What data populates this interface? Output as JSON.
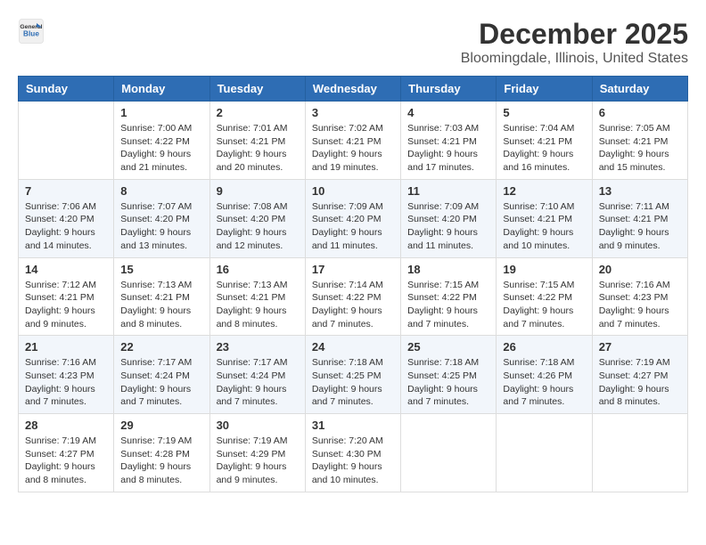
{
  "header": {
    "logo_line1": "General",
    "logo_line2": "Blue",
    "month": "December 2025",
    "location": "Bloomingdale, Illinois, United States"
  },
  "weekdays": [
    "Sunday",
    "Monday",
    "Tuesday",
    "Wednesday",
    "Thursday",
    "Friday",
    "Saturday"
  ],
  "weeks": [
    [
      {
        "day": "",
        "sunrise": "",
        "sunset": "",
        "daylight": ""
      },
      {
        "day": "1",
        "sunrise": "Sunrise: 7:00 AM",
        "sunset": "Sunset: 4:22 PM",
        "daylight": "Daylight: 9 hours and 21 minutes."
      },
      {
        "day": "2",
        "sunrise": "Sunrise: 7:01 AM",
        "sunset": "Sunset: 4:21 PM",
        "daylight": "Daylight: 9 hours and 20 minutes."
      },
      {
        "day": "3",
        "sunrise": "Sunrise: 7:02 AM",
        "sunset": "Sunset: 4:21 PM",
        "daylight": "Daylight: 9 hours and 19 minutes."
      },
      {
        "day": "4",
        "sunrise": "Sunrise: 7:03 AM",
        "sunset": "Sunset: 4:21 PM",
        "daylight": "Daylight: 9 hours and 17 minutes."
      },
      {
        "day": "5",
        "sunrise": "Sunrise: 7:04 AM",
        "sunset": "Sunset: 4:21 PM",
        "daylight": "Daylight: 9 hours and 16 minutes."
      },
      {
        "day": "6",
        "sunrise": "Sunrise: 7:05 AM",
        "sunset": "Sunset: 4:21 PM",
        "daylight": "Daylight: 9 hours and 15 minutes."
      }
    ],
    [
      {
        "day": "7",
        "sunrise": "Sunrise: 7:06 AM",
        "sunset": "Sunset: 4:20 PM",
        "daylight": "Daylight: 9 hours and 14 minutes."
      },
      {
        "day": "8",
        "sunrise": "Sunrise: 7:07 AM",
        "sunset": "Sunset: 4:20 PM",
        "daylight": "Daylight: 9 hours and 13 minutes."
      },
      {
        "day": "9",
        "sunrise": "Sunrise: 7:08 AM",
        "sunset": "Sunset: 4:20 PM",
        "daylight": "Daylight: 9 hours and 12 minutes."
      },
      {
        "day": "10",
        "sunrise": "Sunrise: 7:09 AM",
        "sunset": "Sunset: 4:20 PM",
        "daylight": "Daylight: 9 hours and 11 minutes."
      },
      {
        "day": "11",
        "sunrise": "Sunrise: 7:09 AM",
        "sunset": "Sunset: 4:20 PM",
        "daylight": "Daylight: 9 hours and 11 minutes."
      },
      {
        "day": "12",
        "sunrise": "Sunrise: 7:10 AM",
        "sunset": "Sunset: 4:21 PM",
        "daylight": "Daylight: 9 hours and 10 minutes."
      },
      {
        "day": "13",
        "sunrise": "Sunrise: 7:11 AM",
        "sunset": "Sunset: 4:21 PM",
        "daylight": "Daylight: 9 hours and 9 minutes."
      }
    ],
    [
      {
        "day": "14",
        "sunrise": "Sunrise: 7:12 AM",
        "sunset": "Sunset: 4:21 PM",
        "daylight": "Daylight: 9 hours and 9 minutes."
      },
      {
        "day": "15",
        "sunrise": "Sunrise: 7:13 AM",
        "sunset": "Sunset: 4:21 PM",
        "daylight": "Daylight: 9 hours and 8 minutes."
      },
      {
        "day": "16",
        "sunrise": "Sunrise: 7:13 AM",
        "sunset": "Sunset: 4:21 PM",
        "daylight": "Daylight: 9 hours and 8 minutes."
      },
      {
        "day": "17",
        "sunrise": "Sunrise: 7:14 AM",
        "sunset": "Sunset: 4:22 PM",
        "daylight": "Daylight: 9 hours and 7 minutes."
      },
      {
        "day": "18",
        "sunrise": "Sunrise: 7:15 AM",
        "sunset": "Sunset: 4:22 PM",
        "daylight": "Daylight: 9 hours and 7 minutes."
      },
      {
        "day": "19",
        "sunrise": "Sunrise: 7:15 AM",
        "sunset": "Sunset: 4:22 PM",
        "daylight": "Daylight: 9 hours and 7 minutes."
      },
      {
        "day": "20",
        "sunrise": "Sunrise: 7:16 AM",
        "sunset": "Sunset: 4:23 PM",
        "daylight": "Daylight: 9 hours and 7 minutes."
      }
    ],
    [
      {
        "day": "21",
        "sunrise": "Sunrise: 7:16 AM",
        "sunset": "Sunset: 4:23 PM",
        "daylight": "Daylight: 9 hours and 7 minutes."
      },
      {
        "day": "22",
        "sunrise": "Sunrise: 7:17 AM",
        "sunset": "Sunset: 4:24 PM",
        "daylight": "Daylight: 9 hours and 7 minutes."
      },
      {
        "day": "23",
        "sunrise": "Sunrise: 7:17 AM",
        "sunset": "Sunset: 4:24 PM",
        "daylight": "Daylight: 9 hours and 7 minutes."
      },
      {
        "day": "24",
        "sunrise": "Sunrise: 7:18 AM",
        "sunset": "Sunset: 4:25 PM",
        "daylight": "Daylight: 9 hours and 7 minutes."
      },
      {
        "day": "25",
        "sunrise": "Sunrise: 7:18 AM",
        "sunset": "Sunset: 4:25 PM",
        "daylight": "Daylight: 9 hours and 7 minutes."
      },
      {
        "day": "26",
        "sunrise": "Sunrise: 7:18 AM",
        "sunset": "Sunset: 4:26 PM",
        "daylight": "Daylight: 9 hours and 7 minutes."
      },
      {
        "day": "27",
        "sunrise": "Sunrise: 7:19 AM",
        "sunset": "Sunset: 4:27 PM",
        "daylight": "Daylight: 9 hours and 8 minutes."
      }
    ],
    [
      {
        "day": "28",
        "sunrise": "Sunrise: 7:19 AM",
        "sunset": "Sunset: 4:27 PM",
        "daylight": "Daylight: 9 hours and 8 minutes."
      },
      {
        "day": "29",
        "sunrise": "Sunrise: 7:19 AM",
        "sunset": "Sunset: 4:28 PM",
        "daylight": "Daylight: 9 hours and 8 minutes."
      },
      {
        "day": "30",
        "sunrise": "Sunrise: 7:19 AM",
        "sunset": "Sunset: 4:29 PM",
        "daylight": "Daylight: 9 hours and 9 minutes."
      },
      {
        "day": "31",
        "sunrise": "Sunrise: 7:20 AM",
        "sunset": "Sunset: 4:30 PM",
        "daylight": "Daylight: 9 hours and 10 minutes."
      },
      {
        "day": "",
        "sunrise": "",
        "sunset": "",
        "daylight": ""
      },
      {
        "day": "",
        "sunrise": "",
        "sunset": "",
        "daylight": ""
      },
      {
        "day": "",
        "sunrise": "",
        "sunset": "",
        "daylight": ""
      }
    ]
  ]
}
